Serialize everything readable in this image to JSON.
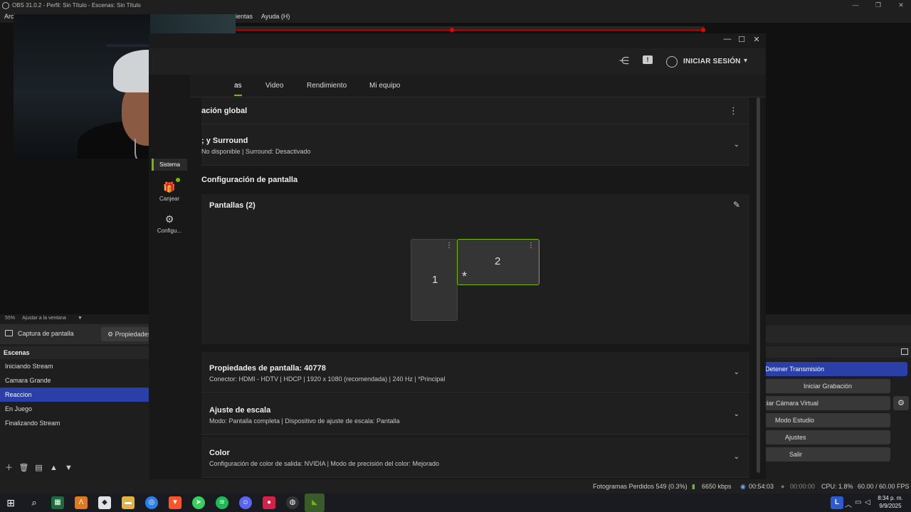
{
  "obs": {
    "window_title": "OBS 31.0.2 - Perfil: Sin Título - Escenas: Sin Título",
    "menu": [
      "Arch",
      "ientas",
      "Ayuda (H)"
    ],
    "preview_scale": "55%",
    "preview_fit": "Ajustar a la ventana",
    "source_name": "Captura de pantalla",
    "properties_label": "Propiedades",
    "scenes_header": "Escenas",
    "scenes": [
      "Iniciando Stream",
      "Camara Grande",
      "Reaccion",
      "En Juego",
      "Finalizando Stream"
    ],
    "active_scene_index": 2,
    "controls": {
      "stop_stream": "Detener Transmisión",
      "start_recording": "Iniciar Grabación",
      "virtual_camera": "ciar Cámara Virtual",
      "studio_mode": "Modo Estudio",
      "settings": "Ajustes",
      "exit": "Salir"
    },
    "status": {
      "dropped_frames": "Fotogramas Perdidos 549 (0.3%)",
      "bitrate": "6650 kbps",
      "stream_time": "00:54:03",
      "record_time": "00:00:00",
      "cpu": "CPU: 1.8%",
      "fps": "60.00 / 60.00 FPS"
    }
  },
  "nvidia": {
    "header": {
      "login_label": "INICIAR SESIÓN"
    },
    "sidebar": {
      "active_label": "Sistema",
      "redeem_label": "Canjear",
      "settings_label": "Configu..."
    },
    "tabs": [
      "as",
      "Video",
      "Rendimiento",
      "Mi equipo"
    ],
    "global_config_title": "ación global",
    "surround_card": {
      "title": "; y Surround",
      "subtitle": "No disponible | Surround: Desactivado"
    },
    "display_section_title": "Configuración de pantalla",
    "screens_title": "Pantallas (2)",
    "monitors": [
      {
        "label": "1",
        "selected": false,
        "primary": false
      },
      {
        "label": "2",
        "selected": true,
        "primary": true
      }
    ],
    "primary_marker": "*",
    "cards": [
      {
        "title": "Propiedades de pantalla: 40778",
        "subtitle": "Conector: HDMI - HDTV | HDCP | 1920 x 1080 (recomendada) | 240 Hz | *Principal"
      },
      {
        "title": "Ajuste de escala",
        "subtitle": "Modo: Pantalla completa | Dispositivo de ajuste de escala: Pantalla"
      },
      {
        "title": "Color",
        "subtitle": "Configuración de color de salida: NVIDIA | Modo de precisión del color: Mejorado"
      }
    ]
  },
  "taskbar": {
    "time": "8:34 p. m.",
    "date": "9/9/2025",
    "lang": "L"
  }
}
